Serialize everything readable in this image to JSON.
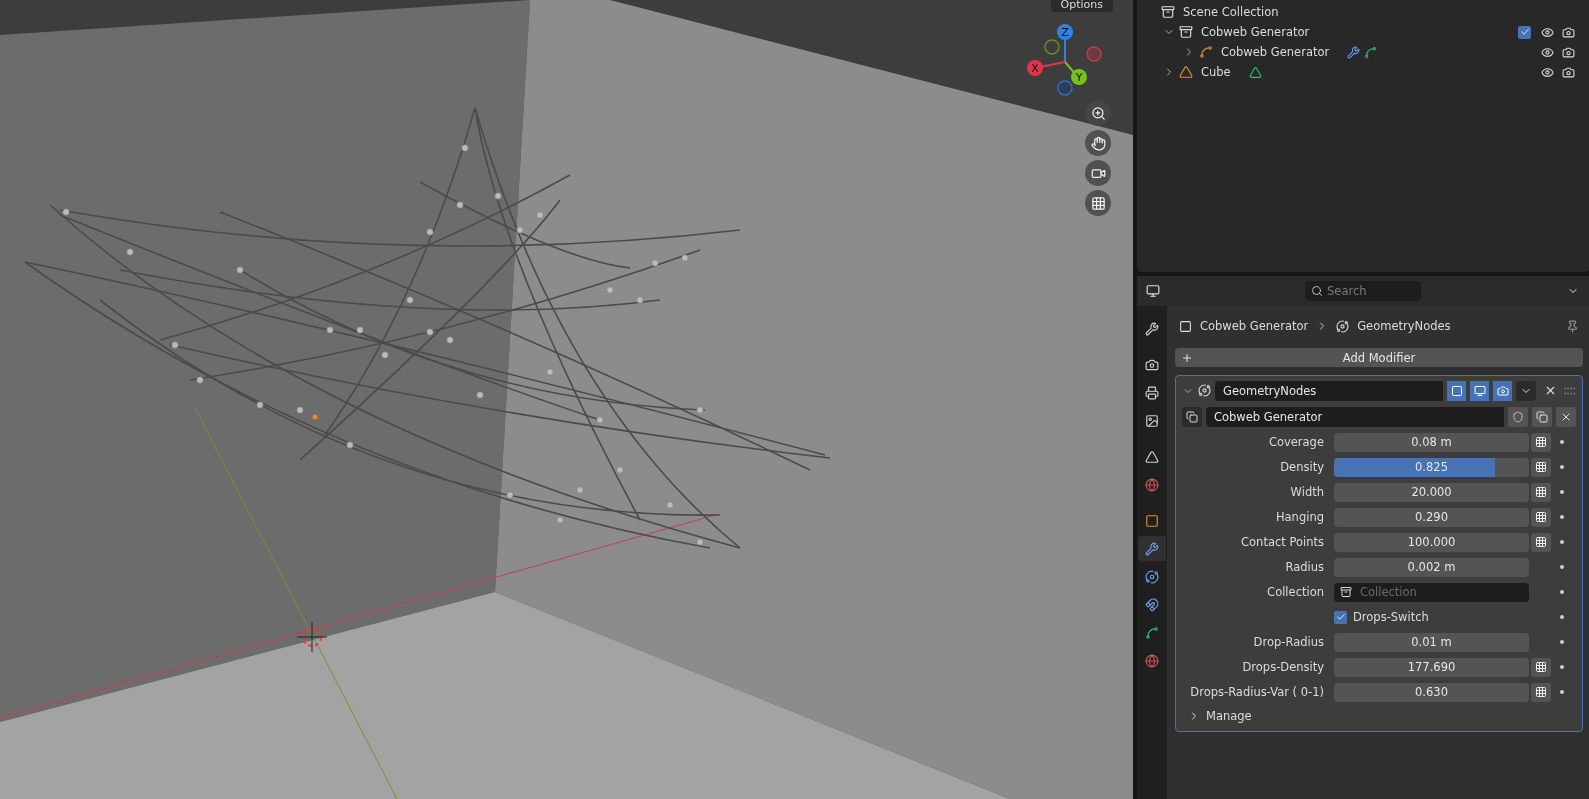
{
  "viewport": {
    "options_label": "Options",
    "gizmo": {
      "x": "X",
      "y": "Y",
      "z": "Z"
    }
  },
  "outliner": {
    "root": "Scene Collection",
    "items": [
      {
        "name": "Cobweb Generator",
        "kind": "collection",
        "expanded": true,
        "checked": true,
        "children": [
          {
            "name": "Cobweb Generator",
            "kind": "curves",
            "expanded": false
          }
        ]
      },
      {
        "name": "Cube",
        "kind": "mesh",
        "expanded": false
      }
    ]
  },
  "properties": {
    "search": {
      "placeholder": "Search"
    },
    "tabs": [
      {
        "kind": "tool",
        "selected": false
      },
      {
        "kind": "render",
        "selected": false
      },
      {
        "kind": "output",
        "selected": false
      },
      {
        "kind": "view_layer",
        "selected": false
      },
      {
        "kind": "scene",
        "selected": false
      },
      {
        "kind": "world",
        "selected": false
      },
      {
        "kind": "object",
        "selected": false
      },
      {
        "kind": "modifiers",
        "selected": true
      },
      {
        "kind": "particles",
        "selected": false
      },
      {
        "kind": "physics",
        "selected": false
      },
      {
        "kind": "data",
        "selected": false
      },
      {
        "kind": "material",
        "selected": false
      }
    ],
    "breadcrumb": [
      "Cobweb Generator",
      "GeometryNodes"
    ],
    "add_modifier": "Add Modifier",
    "modifier": {
      "name": "GeometryNodes",
      "expanded": true,
      "edit_mode": true,
      "viewport": true,
      "render": true,
      "node_group": "Cobweb Generator",
      "inputs": [
        {
          "label": "Coverage",
          "kind": "number",
          "value": "0.08 m",
          "attribute": true
        },
        {
          "label": "Density",
          "kind": "slider",
          "value": "0.825",
          "level": 0.825,
          "attribute": true
        },
        {
          "label": "Width",
          "kind": "number",
          "value": "20.000",
          "attribute": true
        },
        {
          "label": "Hanging",
          "kind": "number",
          "value": "0.290",
          "attribute": true
        },
        {
          "label": "Contact Points",
          "kind": "number",
          "value": "100.000",
          "attribute": true
        },
        {
          "label": "Radius",
          "kind": "number",
          "value": "0.002 m",
          "attribute": false
        },
        {
          "label": "Collection",
          "kind": "collection",
          "placeholder": "Collection"
        },
        {
          "label": "Drops-Switch",
          "kind": "checkbox",
          "checked": true
        },
        {
          "label": "Drop-Radius",
          "kind": "number",
          "value": "0.01 m",
          "attribute": false
        },
        {
          "label": "Drops-Density",
          "kind": "number",
          "value": "177.690",
          "attribute": true
        },
        {
          "label": "Drops-Radius-Var ( 0-1)",
          "kind": "number",
          "value": "0.630",
          "attribute": true
        }
      ],
      "subpanel": {
        "label": "Manage",
        "expanded": false
      }
    }
  }
}
